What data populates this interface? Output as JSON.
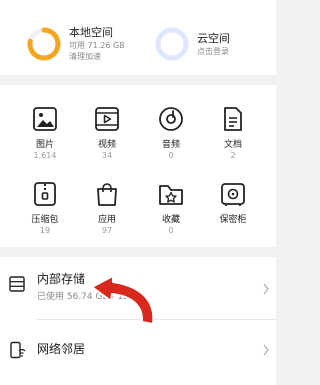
{
  "storage": {
    "local": {
      "title": "本地空间",
      "available": "可用 71.26 GB",
      "action": "清理加速",
      "used_fraction": 0.78
    },
    "cloud": {
      "title": "云空间",
      "action": "点击登录"
    }
  },
  "categories": [
    {
      "label": "图片",
      "count": "1,614",
      "icon": "image-icon"
    },
    {
      "label": "视频",
      "count": "34",
      "icon": "video-icon"
    },
    {
      "label": "音频",
      "count": "0",
      "icon": "audio-icon"
    },
    {
      "label": "文档",
      "count": "2",
      "icon": "document-icon"
    },
    {
      "label": "压缩包",
      "count": "19",
      "icon": "archive-icon"
    },
    {
      "label": "应用",
      "count": "97",
      "icon": "app-bag-icon"
    },
    {
      "label": "收藏",
      "count": "0",
      "icon": "favorite-folder-icon"
    },
    {
      "label": "保密柜",
      "count": "",
      "icon": "safe-icon"
    }
  ],
  "rows": {
    "internal": {
      "title": "内部存储",
      "sub": "已使用 56.74 GB / 128"
    },
    "network": {
      "title": "网络邻居"
    }
  },
  "colors": {
    "accent": "#f5a623",
    "cloud_ring": "#dfe6ff",
    "arrow": "#d9281e"
  }
}
